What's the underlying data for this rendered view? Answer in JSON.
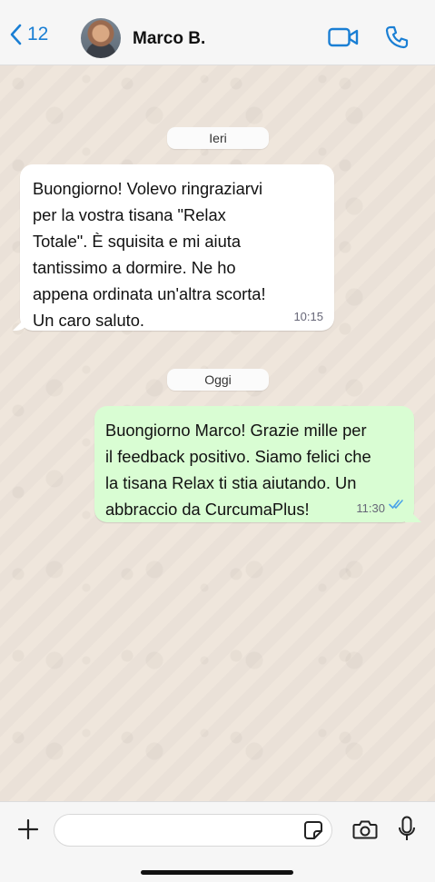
{
  "header": {
    "back_count": "12",
    "contact_name": "Marco B."
  },
  "chat": {
    "date_yesterday": "Ieri",
    "date_today": "Oggi",
    "messages": [
      {
        "direction": "incoming",
        "text": "Buongiorno! Volevo ringraziarvi\nper la vostra tisana \"Relax\nTotale\". È squisita e mi aiuta\ntantissimo a dormire. Ne ho\nappena ordinata un'altra scorta!\nUn caro saluto.",
        "time": "10:15"
      },
      {
        "direction": "outgoing",
        "text": "Buongiorno Marco! Grazie mille per\nil feedback positivo. Siamo felici che\nla tisana Relax ti stia aiutando. Un\nabbraccio da CurcumaPlus!",
        "time": "11:30",
        "status": "read"
      }
    ]
  },
  "input": {
    "value": "",
    "placeholder": ""
  },
  "colors": {
    "accent": "#1a7fd4",
    "outgoing_bubble": "#d9fdd3",
    "incoming_bubble": "#ffffff",
    "read_ticks": "#4aa3e8"
  }
}
